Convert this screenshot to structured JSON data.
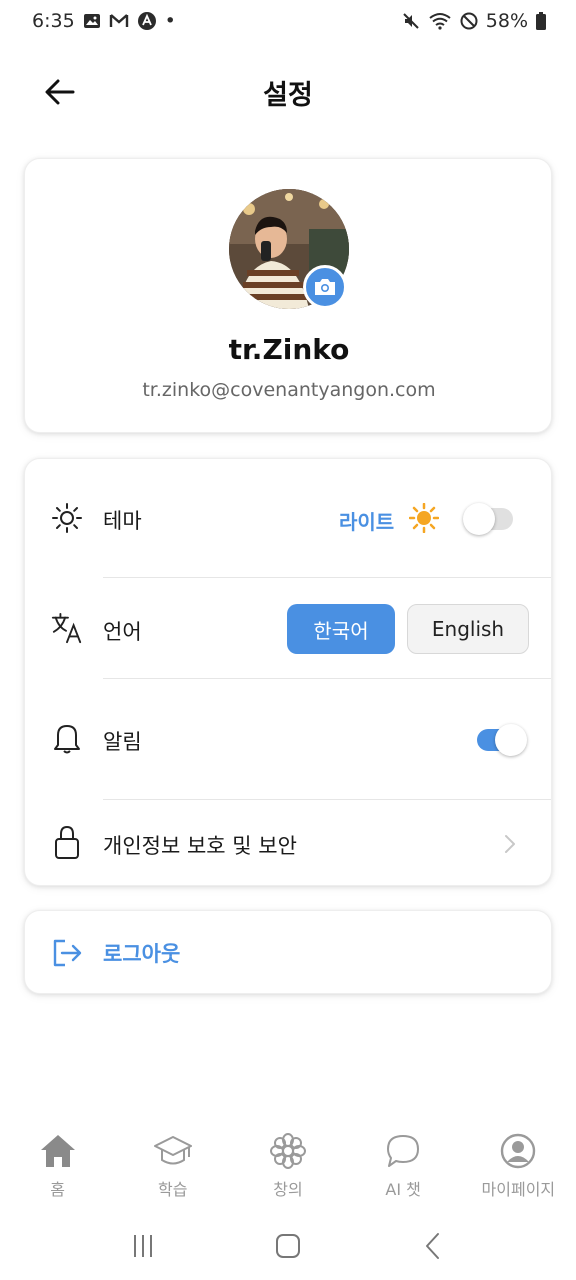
{
  "status_bar": {
    "time": "6:35",
    "dot": "•",
    "battery": "58%",
    "icons_left": [
      "gallery-icon",
      "gmail-icon",
      "app-icon"
    ],
    "icons_right": [
      "mute-icon",
      "wifi-icon",
      "no-disturb-icon",
      "battery-icon"
    ]
  },
  "header": {
    "title": "설정",
    "back_icon": "arrow-left-icon"
  },
  "profile": {
    "name": "tr.Zinko",
    "email": "tr.zinko@covenantyangon.com",
    "camera_icon": "camera-icon"
  },
  "settings": {
    "theme": {
      "label": "테마",
      "value": "라이트",
      "sun": "☀️",
      "enabled": false
    },
    "language": {
      "label": "언어",
      "options": [
        "한국어",
        "English"
      ],
      "selected": "한국어"
    },
    "notifications": {
      "label": "알림",
      "enabled": true
    },
    "privacy": {
      "label": "개인정보 보호 및 보안"
    }
  },
  "logout": {
    "label": "로그아웃"
  },
  "bottom_nav": [
    {
      "label": "홈",
      "icon": "home-icon",
      "active": true
    },
    {
      "label": "학습",
      "icon": "graduation-cap-icon",
      "active": false
    },
    {
      "label": "창의",
      "icon": "flower-icon",
      "active": false
    },
    {
      "label": "AI 챗",
      "icon": "chat-bubble-icon",
      "active": false
    },
    {
      "label": "마이페이지",
      "icon": "user-circle-icon",
      "active": false
    }
  ],
  "colors": {
    "accent": "#4a90e2",
    "icon_gray": "#9a9a9a",
    "home_active": "#8a8a8a"
  }
}
